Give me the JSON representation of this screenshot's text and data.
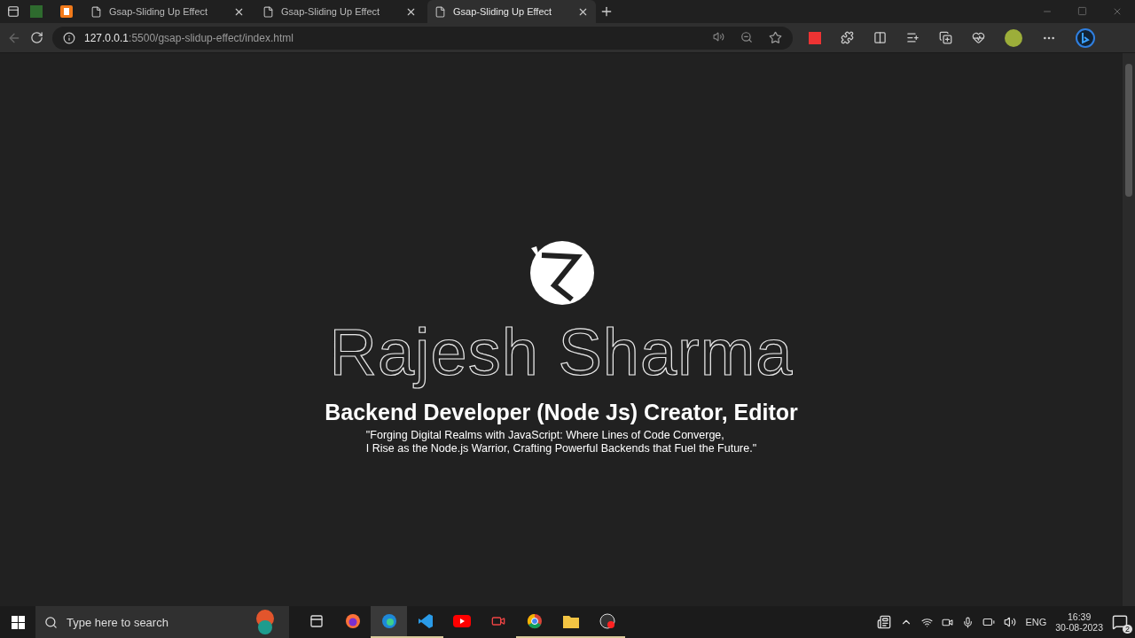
{
  "browser": {
    "pinned_tabs": [
      {
        "kind": "px"
      },
      {
        "kind": "f"
      }
    ],
    "tabs": [
      {
        "title": "Gsap-Sliding Up Effect",
        "selected": false
      },
      {
        "title": "Gsap-Sliding Up Effect",
        "selected": false
      },
      {
        "title": "Gsap-Sliding Up Effect",
        "selected": true
      }
    ],
    "address": {
      "host": "127.0.0.1",
      "path": ":5500/gsap-slidup-effect/index.html"
    }
  },
  "page": {
    "name": "Rajesh Sharma",
    "role": "Backend Developer (Node Js) Creator, Editor",
    "quote_lines": [
      "\"Forging Digital Realms with JavaScript: Where Lines of Code Converge,",
      "I Rise as the Node.js Warrior, Crafting Powerful Backends that Fuel the Future.\""
    ]
  },
  "taskbar": {
    "search": {
      "placeholder": "Type here to search"
    },
    "apps": [
      {
        "kind": "taskview",
        "running": false,
        "selected": false
      },
      {
        "kind": "firefox",
        "running": false,
        "selected": false
      },
      {
        "kind": "edge",
        "running": true,
        "selected": true
      },
      {
        "kind": "vscode",
        "running": true,
        "selected": false
      },
      {
        "kind": "youtube",
        "running": false,
        "selected": false
      },
      {
        "kind": "recorder",
        "running": false,
        "selected": false
      },
      {
        "kind": "chrome",
        "running": true,
        "selected": false
      },
      {
        "kind": "explorer",
        "running": true,
        "selected": false
      },
      {
        "kind": "obs",
        "running": true,
        "selected": false
      }
    ],
    "language": "ENG",
    "time": "16:39",
    "date": "30-08-2023",
    "notifications": "2"
  }
}
